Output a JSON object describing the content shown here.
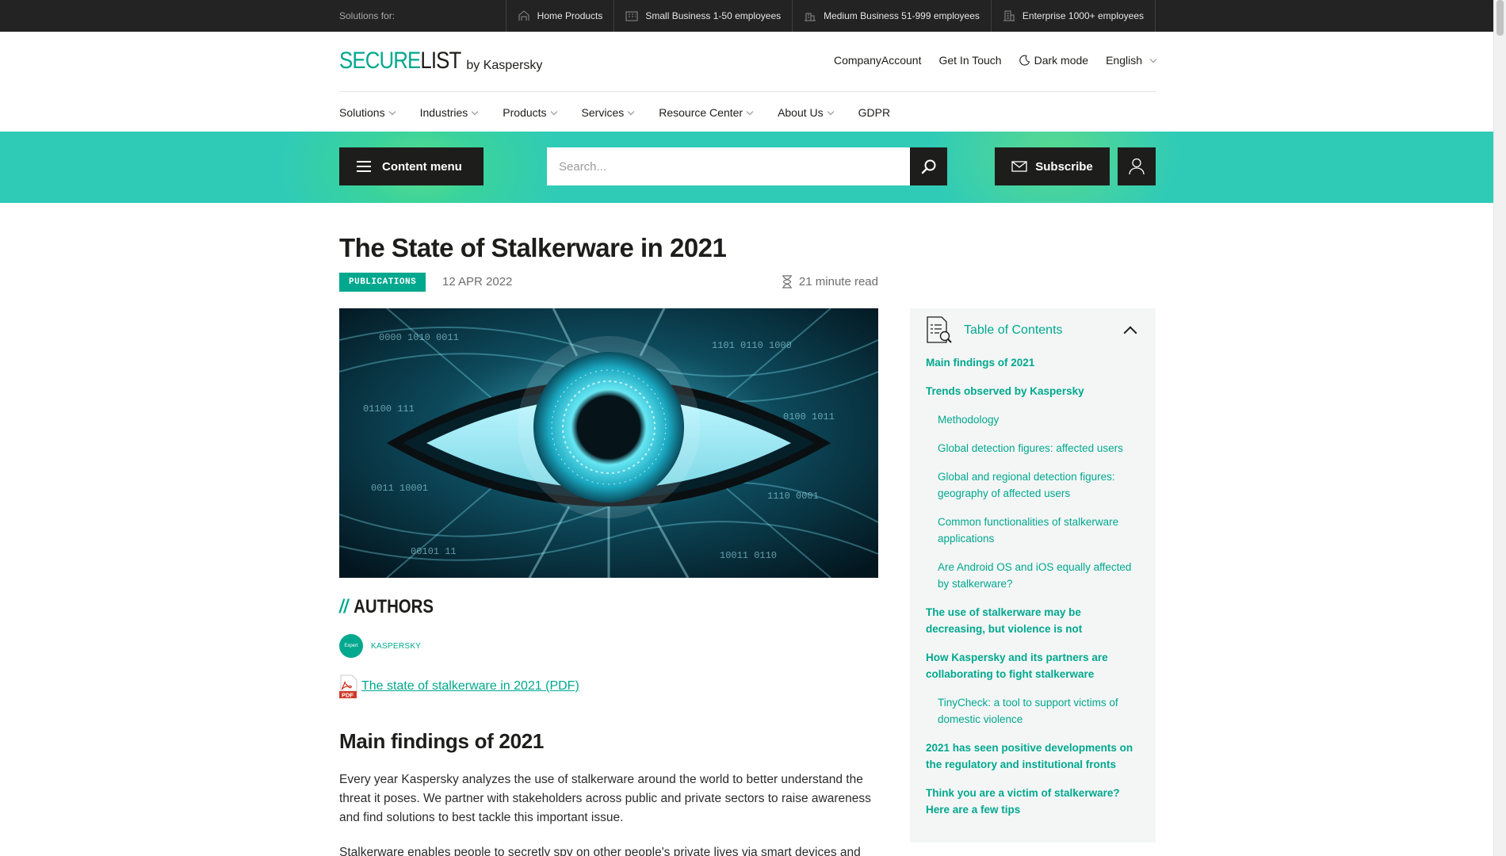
{
  "topbar": {
    "label": "Solutions for:",
    "segments": [
      {
        "label": "Home Products",
        "icon": "home-icon"
      },
      {
        "label": "Small Business 1-50 employees",
        "icon": "small-business-icon"
      },
      {
        "label": "Medium Business 51-999 employees",
        "icon": "medium-business-icon"
      },
      {
        "label": "Enterprise 1000+ employees",
        "icon": "enterprise-icon"
      }
    ]
  },
  "header": {
    "logo_secure": "SECURE",
    "logo_list": "LIST",
    "byline": "by Kaspersky",
    "links": {
      "company_account": "CompanyAccount",
      "get_in_touch": "Get In Touch",
      "dark_mode": "Dark mode",
      "language": "English"
    }
  },
  "nav": {
    "items": [
      "Solutions",
      "Industries",
      "Products",
      "Services",
      "Resource Center",
      "About Us",
      "GDPR"
    ]
  },
  "band": {
    "content_menu": "Content menu",
    "search_placeholder": "Search...",
    "subscribe": "Subscribe"
  },
  "article": {
    "title": "The State of Stalkerware in 2021",
    "tag": "PUBLICATIONS",
    "date": "12 APR 2022",
    "read_time": "21 minute read",
    "authors_slashes": "//",
    "authors_heading": "AUTHORS",
    "author_avatar_text": "Expert",
    "author_name": "KASPERSKY",
    "pdf_badge": "PDF",
    "pdf_link": "The state of stalkerware in 2021 (PDF)",
    "section_heading": "Main findings of 2021",
    "paragraph_1": "Every year Kaspersky analyzes the use of stalkerware around the world to better understand the threat it poses. We partner with stakeholders across public and private sectors to raise awareness and find solutions to best tackle this important issue.",
    "paragraph_2": "Stalkerware enables people to secretly spy on other people's private lives via smart devices and"
  },
  "toc": {
    "title": "Table of Contents",
    "items": [
      {
        "label": "Main findings of 2021",
        "level": 1
      },
      {
        "label": "Trends observed by Kaspersky",
        "level": 1
      },
      {
        "label": "Methodology",
        "level": 2
      },
      {
        "label": "Global detection figures: affected users",
        "level": 2
      },
      {
        "label": "Global and regional detection figures: geography of affected users",
        "level": 2
      },
      {
        "label": "Common functionalities of stalkerware applications",
        "level": 2
      },
      {
        "label": "Are Android OS and iOS equally affected by stalkerware?",
        "level": 2
      },
      {
        "label": "The use of stalkerware may be decreasing, but violence is not",
        "level": 1
      },
      {
        "label": "How Kaspersky and its partners are collaborating to fight stalkerware",
        "level": 1
      },
      {
        "label": "TinyCheck: a tool to support victims of domestic violence",
        "level": 2
      },
      {
        "label": "2021 has seen positive developments on the regulatory and institutional fronts",
        "level": 1
      },
      {
        "label": "Think you are a victim of stalkerware? Here are a few tips",
        "level": 1
      }
    ]
  },
  "colors": {
    "accent": "#00a88e",
    "band": "#2fcbb7",
    "dark": "#1d1d1b"
  }
}
